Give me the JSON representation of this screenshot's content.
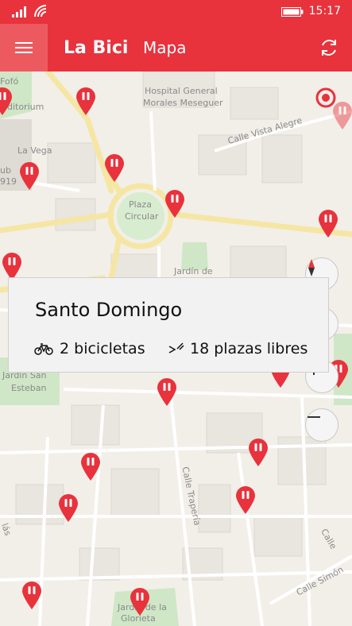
{
  "statusbar": {
    "time": "15:17"
  },
  "appbar": {
    "title": "La Bici",
    "subtitle": "Mapa",
    "menu_icon": "hamburger-icon",
    "refresh_icon": "refresh-icon"
  },
  "map": {
    "labels": {
      "hospital": "Hospital General",
      "hospital2": "Morales Meseguer",
      "calle_vista_alegre": "Calle Vista Alegre",
      "auditorium": "uditorium",
      "la_vega": "La Vega",
      "club": "ub",
      "club_num": "919",
      "fofo": "Fofó",
      "plaza_circular": "Plaza",
      "plaza_circular2": "Circular",
      "jardin_de": "Jardín de",
      "jardin_san": "Jardín San",
      "esteban": "Esteban",
      "calle_traperia": "Calle Trapería",
      "calle_simon": "Calle Simón",
      "jardin_glorieta": "Jardín de la",
      "glorieta": "Glorieta",
      "calle": "Calle",
      "las": "lás"
    }
  },
  "station": {
    "name": "Santo Domingo",
    "bikes": "2 bicicletas",
    "slots": "18 plazas libres"
  }
}
